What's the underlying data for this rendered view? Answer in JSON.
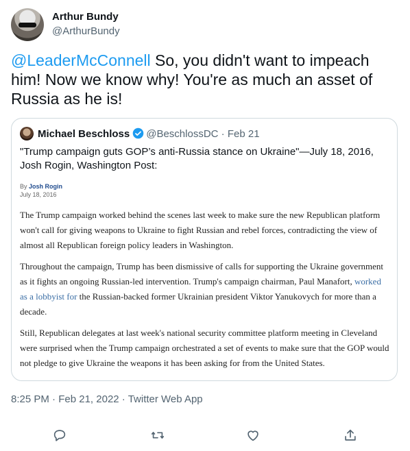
{
  "author": {
    "name": "Arthur Bundy",
    "handle": "@ArthurBundy"
  },
  "tweet": {
    "mention": "@LeaderMcConnell",
    "text": " So, you didn't want to impeach him! Now we know why! You're as much an asset of Russia as he is!"
  },
  "quote": {
    "name": "Michael Beschloss",
    "handle": "@BeschlossDC",
    "sep": " · ",
    "date": "Feb 21",
    "text": "\"Trump campaign guts GOP’s anti-Russia stance on Ukraine\"—July 18, 2016, Josh Rogin, Washington Post:",
    "article": {
      "by_prefix": "By ",
      "by_author": "Josh Rogin",
      "date": "July 18, 2016",
      "p1": "The Trump campaign worked behind the scenes last week to make sure the new Republican platform won't call for giving weapons to Ukraine to fight Russian and rebel forces, contradicting the view of almost all Republican foreign policy leaders in Washington.",
      "p2_a": "Throughout the campaign, Trump has been dismissive of calls for supporting the Ukraine government as it fights an ongoing Russian-led intervention. Trump's campaign chairman, Paul Manafort, ",
      "p2_link": "worked as a lobbyist for",
      "p2_b": " the Russian-backed former Ukrainian president Viktor Yanukovych for more than a decade.",
      "p3": "Still, Republican delegates at last week's national security committee platform meeting in Cleveland were surprised when the Trump campaign orchestrated a set of events to make sure that the GOP would not pledge to give Ukraine the weapons it has been asking for from the United States."
    }
  },
  "meta": {
    "time": "8:25 PM",
    "date": "Feb 21, 2022",
    "source": "Twitter Web App",
    "sep": " · "
  },
  "actions": {
    "icons": [
      "reply-icon",
      "retweet-icon",
      "like-icon",
      "share-icon"
    ]
  },
  "colors": {
    "accent": "#1d9bf0",
    "secondary_text": "#536471",
    "border": "#cfd9de"
  }
}
